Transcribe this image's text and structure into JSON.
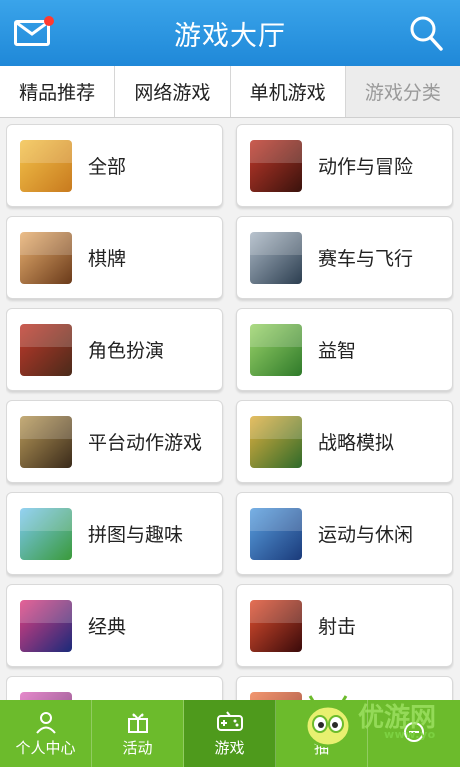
{
  "header": {
    "title": "游戏大厅"
  },
  "tabs": [
    {
      "label": "精品推荐",
      "active": false
    },
    {
      "label": "网络游戏",
      "active": false
    },
    {
      "label": "单机游戏",
      "active": false
    },
    {
      "label": "游戏分类",
      "active": true
    }
  ],
  "categories": [
    {
      "label": "全部",
      "icon": "all-games-thumbnail-icon",
      "color": "#e8a830"
    },
    {
      "label": "动作与冒险",
      "icon": "action-adventure-thumbnail-icon",
      "color": "#8a2a1e"
    },
    {
      "label": "棋牌",
      "icon": "card-board-thumbnail-icon",
      "color": "#c98a3a"
    },
    {
      "label": "赛车与飞行",
      "icon": "racing-flying-thumbnail-icon",
      "color": "#5d6d7e"
    },
    {
      "label": "角色扮演",
      "icon": "role-playing-thumbnail-icon",
      "color": "#7a4a2e"
    },
    {
      "label": "益智",
      "icon": "puzzle-thumbnail-icon",
      "color": "#5aa43a"
    },
    {
      "label": "平台动作游戏",
      "icon": "platform-action-thumbnail-icon",
      "color": "#6b5a3a"
    },
    {
      "label": "战略模拟",
      "icon": "strategy-simulation-thumbnail-icon",
      "color": "#3f8a3a"
    },
    {
      "label": "拼图与趣味",
      "icon": "jigsaw-fun-thumbnail-icon",
      "color": "#3b9be0"
    },
    {
      "label": "运动与休闲",
      "icon": "sports-leisure-thumbnail-icon",
      "color": "#2f6fb0"
    },
    {
      "label": "经典",
      "icon": "classic-thumbnail-icon",
      "color": "#2a3a8a"
    },
    {
      "label": "射击",
      "icon": "shooting-thumbnail-icon",
      "color": "#8a1e1e"
    },
    {
      "label": "",
      "icon": "more-thumbnail-icon",
      "color": "#c040a0"
    },
    {
      "label": "",
      "icon": "more-thumbnail-icon",
      "color": "#d05030"
    }
  ],
  "bottom_nav": [
    {
      "label": "个人中心",
      "icon": "person-icon",
      "active": false
    },
    {
      "label": "活动",
      "icon": "gift-icon",
      "active": false
    },
    {
      "label": "游戏",
      "icon": "gamepad-icon",
      "active": true
    },
    {
      "label": "抽",
      "icon": "lottery-icon",
      "active": false
    },
    {
      "label": "",
      "icon": "more-icon",
      "active": false
    }
  ],
  "colors": {
    "header": "#2896e0",
    "bottom_nav": "#6cbb2c",
    "bottom_nav_active": "#4e9a1c",
    "notification_dot": "#ff3b30"
  },
  "watermark": {
    "text": "www.yo"
  }
}
